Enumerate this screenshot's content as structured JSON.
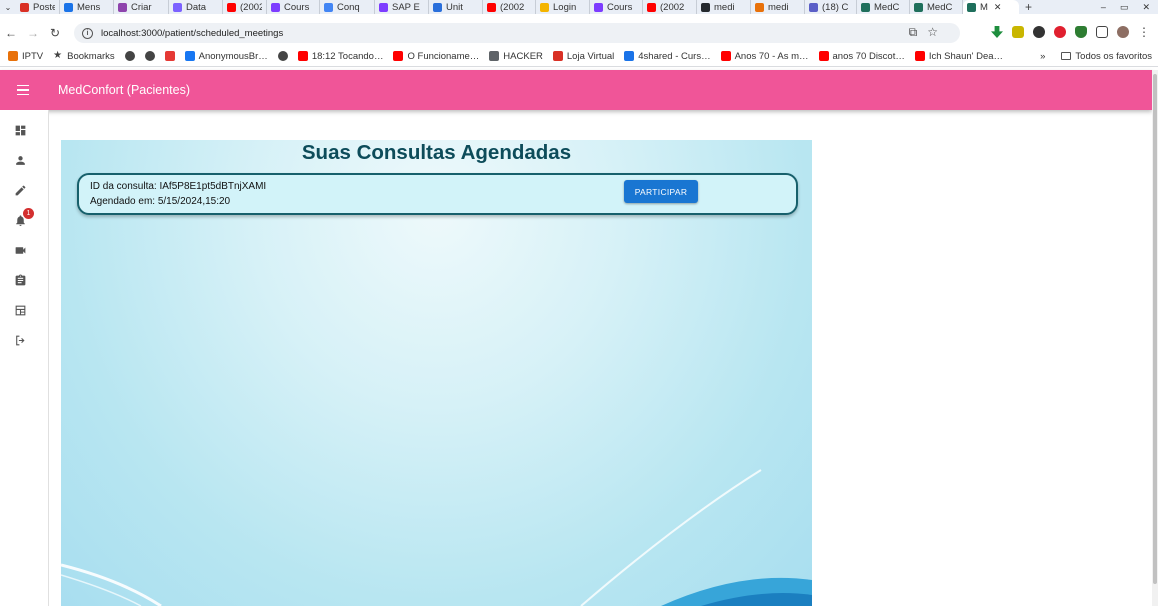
{
  "browser": {
    "tabs": [
      {
        "title": "Poste",
        "color": "#d93025"
      },
      {
        "title": "Mens",
        "color": "#1a73e8"
      },
      {
        "title": "Criar",
        "color": "#8e44ad"
      },
      {
        "title": "Data",
        "color": "#7b61ff"
      },
      {
        "title": "(2002",
        "color": "#ff0000"
      },
      {
        "title": "Cours",
        "color": "#7d3cff"
      },
      {
        "title": "Conq",
        "color": "#4285f4"
      },
      {
        "title": "SAP E",
        "color": "#7d3cff"
      },
      {
        "title": "Unit",
        "color": "#2a6fdb"
      },
      {
        "title": "(2002",
        "color": "#ff0000"
      },
      {
        "title": "Login",
        "color": "#f4b400"
      },
      {
        "title": "Cours",
        "color": "#7d3cff"
      },
      {
        "title": "(2002",
        "color": "#ff0000"
      },
      {
        "title": "medi",
        "color": "#24292e"
      },
      {
        "title": "medi",
        "color": "#e8710a"
      },
      {
        "title": "(18) C",
        "color": "#5b5fc7"
      },
      {
        "title": "MedC",
        "color": "#1f6f5c"
      },
      {
        "title": "MedC",
        "color": "#1f6f5c"
      },
      {
        "title": "M",
        "color": "#1f6f5c",
        "active": true
      }
    ],
    "url": "localhost:3000/patient/scheduled_meetings",
    "bookmarks": [
      {
        "label": "IPTV",
        "color": "#e8710a"
      },
      {
        "label": "Bookmarks",
        "color": "#444444"
      },
      {
        "label": "",
        "color": "#444444"
      },
      {
        "label": "",
        "color": "#444444"
      },
      {
        "label": "",
        "color": "#e53935"
      },
      {
        "label": "AnonymousBr…",
        "color": "#1877f2"
      },
      {
        "label": "",
        "color": "#444444"
      },
      {
        "label": "18:12 Tocando…",
        "color": "#ff0000"
      },
      {
        "label": "O Funcioname…",
        "color": "#ff0000"
      },
      {
        "label": "HACKER",
        "color": "#5f6368"
      },
      {
        "label": "Loja Virtual",
        "color": "#d93025"
      },
      {
        "label": "4shared - Curs…",
        "color": "#1a73e8"
      },
      {
        "label": "Anos 70 - As m…",
        "color": "#ff0000"
      },
      {
        "label": "anos 70 Discot…",
        "color": "#ff0000"
      },
      {
        "label": "Ich Shaun' Dea…",
        "color": "#ff0000"
      }
    ],
    "bookmarks_more": "»",
    "all_bookmarks_label": "Todos os favoritos"
  },
  "app": {
    "title": "MedConfort (Pacientes)",
    "accent_color": "#f05598",
    "notifications_count": "1"
  },
  "sidebar": {
    "items": [
      {
        "name": "dashboard-icon"
      },
      {
        "name": "person-icon"
      },
      {
        "name": "edit-pencil-icon"
      },
      {
        "name": "notifications-bell-icon"
      },
      {
        "name": "video-camera-icon"
      },
      {
        "name": "clipboard-icon"
      },
      {
        "name": "calendar-table-icon"
      },
      {
        "name": "logout-icon"
      }
    ]
  },
  "main": {
    "heading": "Suas Consultas Agendadas",
    "meetings": [
      {
        "id_line": "ID da consulta: IAf5P8E1pt5dBTnjXAMI",
        "scheduled_line": "Agendado em: 5/15/2024,15:20",
        "join_label": "PARTICIPAR"
      }
    ]
  }
}
